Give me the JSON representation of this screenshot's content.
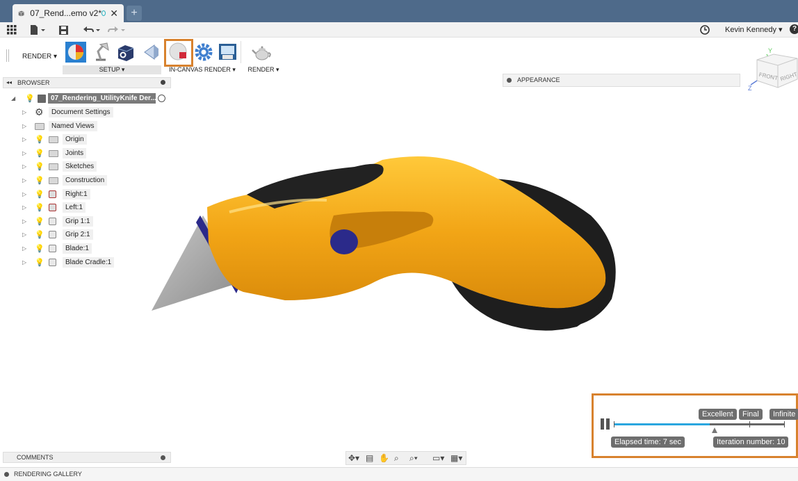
{
  "titlebar": {
    "tab_title": "07_Rend...emo v2*",
    "close_glyph": "✕",
    "new_tab_glyph": "+"
  },
  "qat": {
    "user_name": "Kevin Kennedy ▾",
    "help_glyph": "?"
  },
  "ribbon": {
    "workspace": "RENDER ▾",
    "panels": {
      "setup": "SETUP ▾",
      "in_canvas": "IN-CANVAS RENDER ▾",
      "render": "RENDER ▾"
    }
  },
  "browser": {
    "title": "BROWSER",
    "root": "07_Rendering_UtilityKnife Der...",
    "items": [
      {
        "label": "Document Settings",
        "icon": "gear-icon"
      },
      {
        "label": "Named Views",
        "icon": "folder-icon"
      },
      {
        "label": "Origin",
        "icon": "folder-icon"
      },
      {
        "label": "Joints",
        "icon": "folder-icon"
      },
      {
        "label": "Sketches",
        "icon": "folder-icon"
      },
      {
        "label": "Construction",
        "icon": "folder-icon"
      },
      {
        "label": "Right:1",
        "icon": "component-icon"
      },
      {
        "label": "Left:1",
        "icon": "component-icon"
      },
      {
        "label": "Grip 1:1",
        "icon": "body-icon"
      },
      {
        "label": "Grip 2:1",
        "icon": "body-icon"
      },
      {
        "label": "Blade:1",
        "icon": "body-icon"
      },
      {
        "label": "Blade Cradle:1",
        "icon": "body-icon"
      }
    ]
  },
  "appearance": {
    "title": "APPEARANCE"
  },
  "viewcube": {
    "front": "FRONT",
    "right": "RIGHT",
    "axis_y": "Y",
    "axis_z": "Z"
  },
  "render_progress": {
    "quality_levels": [
      "Excellent",
      "Final",
      "Infinite"
    ],
    "elapsed": "Elapsed time: 7 sec",
    "iteration": "Iteration number: 10",
    "progress_fraction": 0.56,
    "accent_color": "#2aa6df"
  },
  "comments": {
    "title": "COMMENTS"
  },
  "gallery": {
    "title": "RENDERING GALLERY"
  },
  "colors": {
    "titlebar": "#4e6a8a",
    "highlight": "#d8822e",
    "handle_yellow": "#f2a516",
    "grip_black": "#1e1e1e",
    "blade_navy": "#2b2a8a"
  }
}
